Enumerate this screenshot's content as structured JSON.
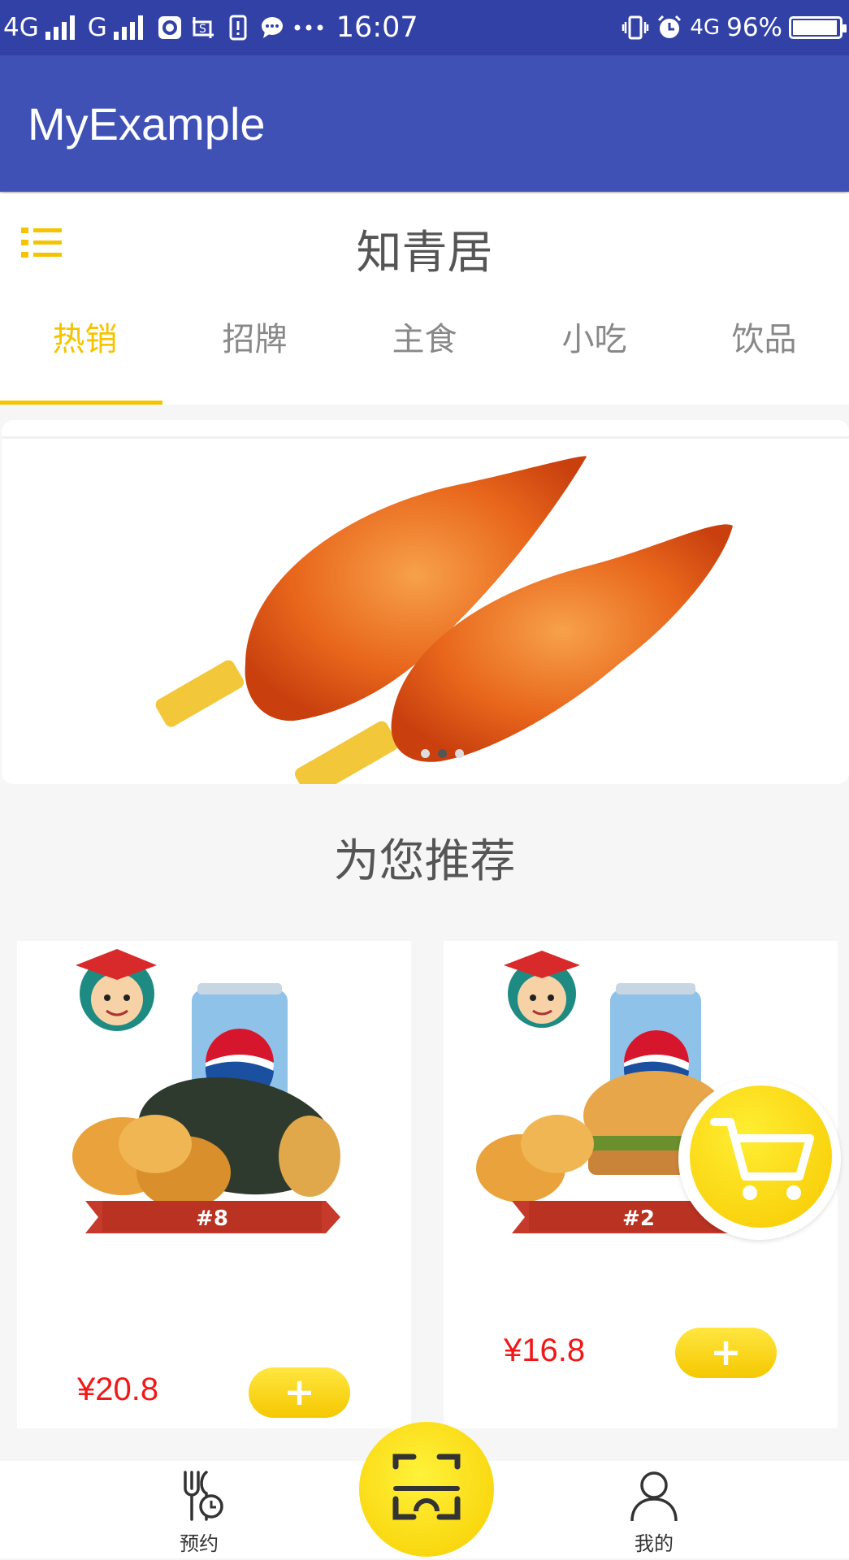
{
  "status_bar": {
    "net1": "4G",
    "net2": "G",
    "time": "16:07",
    "net3": "4G",
    "battery": "96%"
  },
  "app": {
    "title": "MyExample"
  },
  "header": {
    "shop_name": "知青居",
    "tabs": [
      {
        "label": "热销",
        "active": true
      },
      {
        "label": "招牌",
        "active": false
      },
      {
        "label": "主食",
        "active": false
      },
      {
        "label": "小吃",
        "active": false
      },
      {
        "label": "饮品",
        "active": false
      }
    ]
  },
  "banner": {
    "page_indicator": {
      "count": 3,
      "current": 2
    }
  },
  "recommend": {
    "title": "为您推荐",
    "items": [
      {
        "badge": "#8",
        "price": "¥20.8",
        "add_label": "+"
      },
      {
        "badge": "#2",
        "price": "¥16.8",
        "add_label": "+"
      }
    ]
  },
  "bottom_nav": {
    "reserve_label": "预约",
    "mine_label": "我的"
  },
  "colors": {
    "status_bar": "#3241a6",
    "app_bar": "#3f51b5",
    "accent_yellow": "#f5c400",
    "price_red": "#f01818"
  },
  "icons": [
    "list-icon",
    "cart-icon",
    "scan-icon",
    "dining-clock-icon",
    "person-icon"
  ]
}
